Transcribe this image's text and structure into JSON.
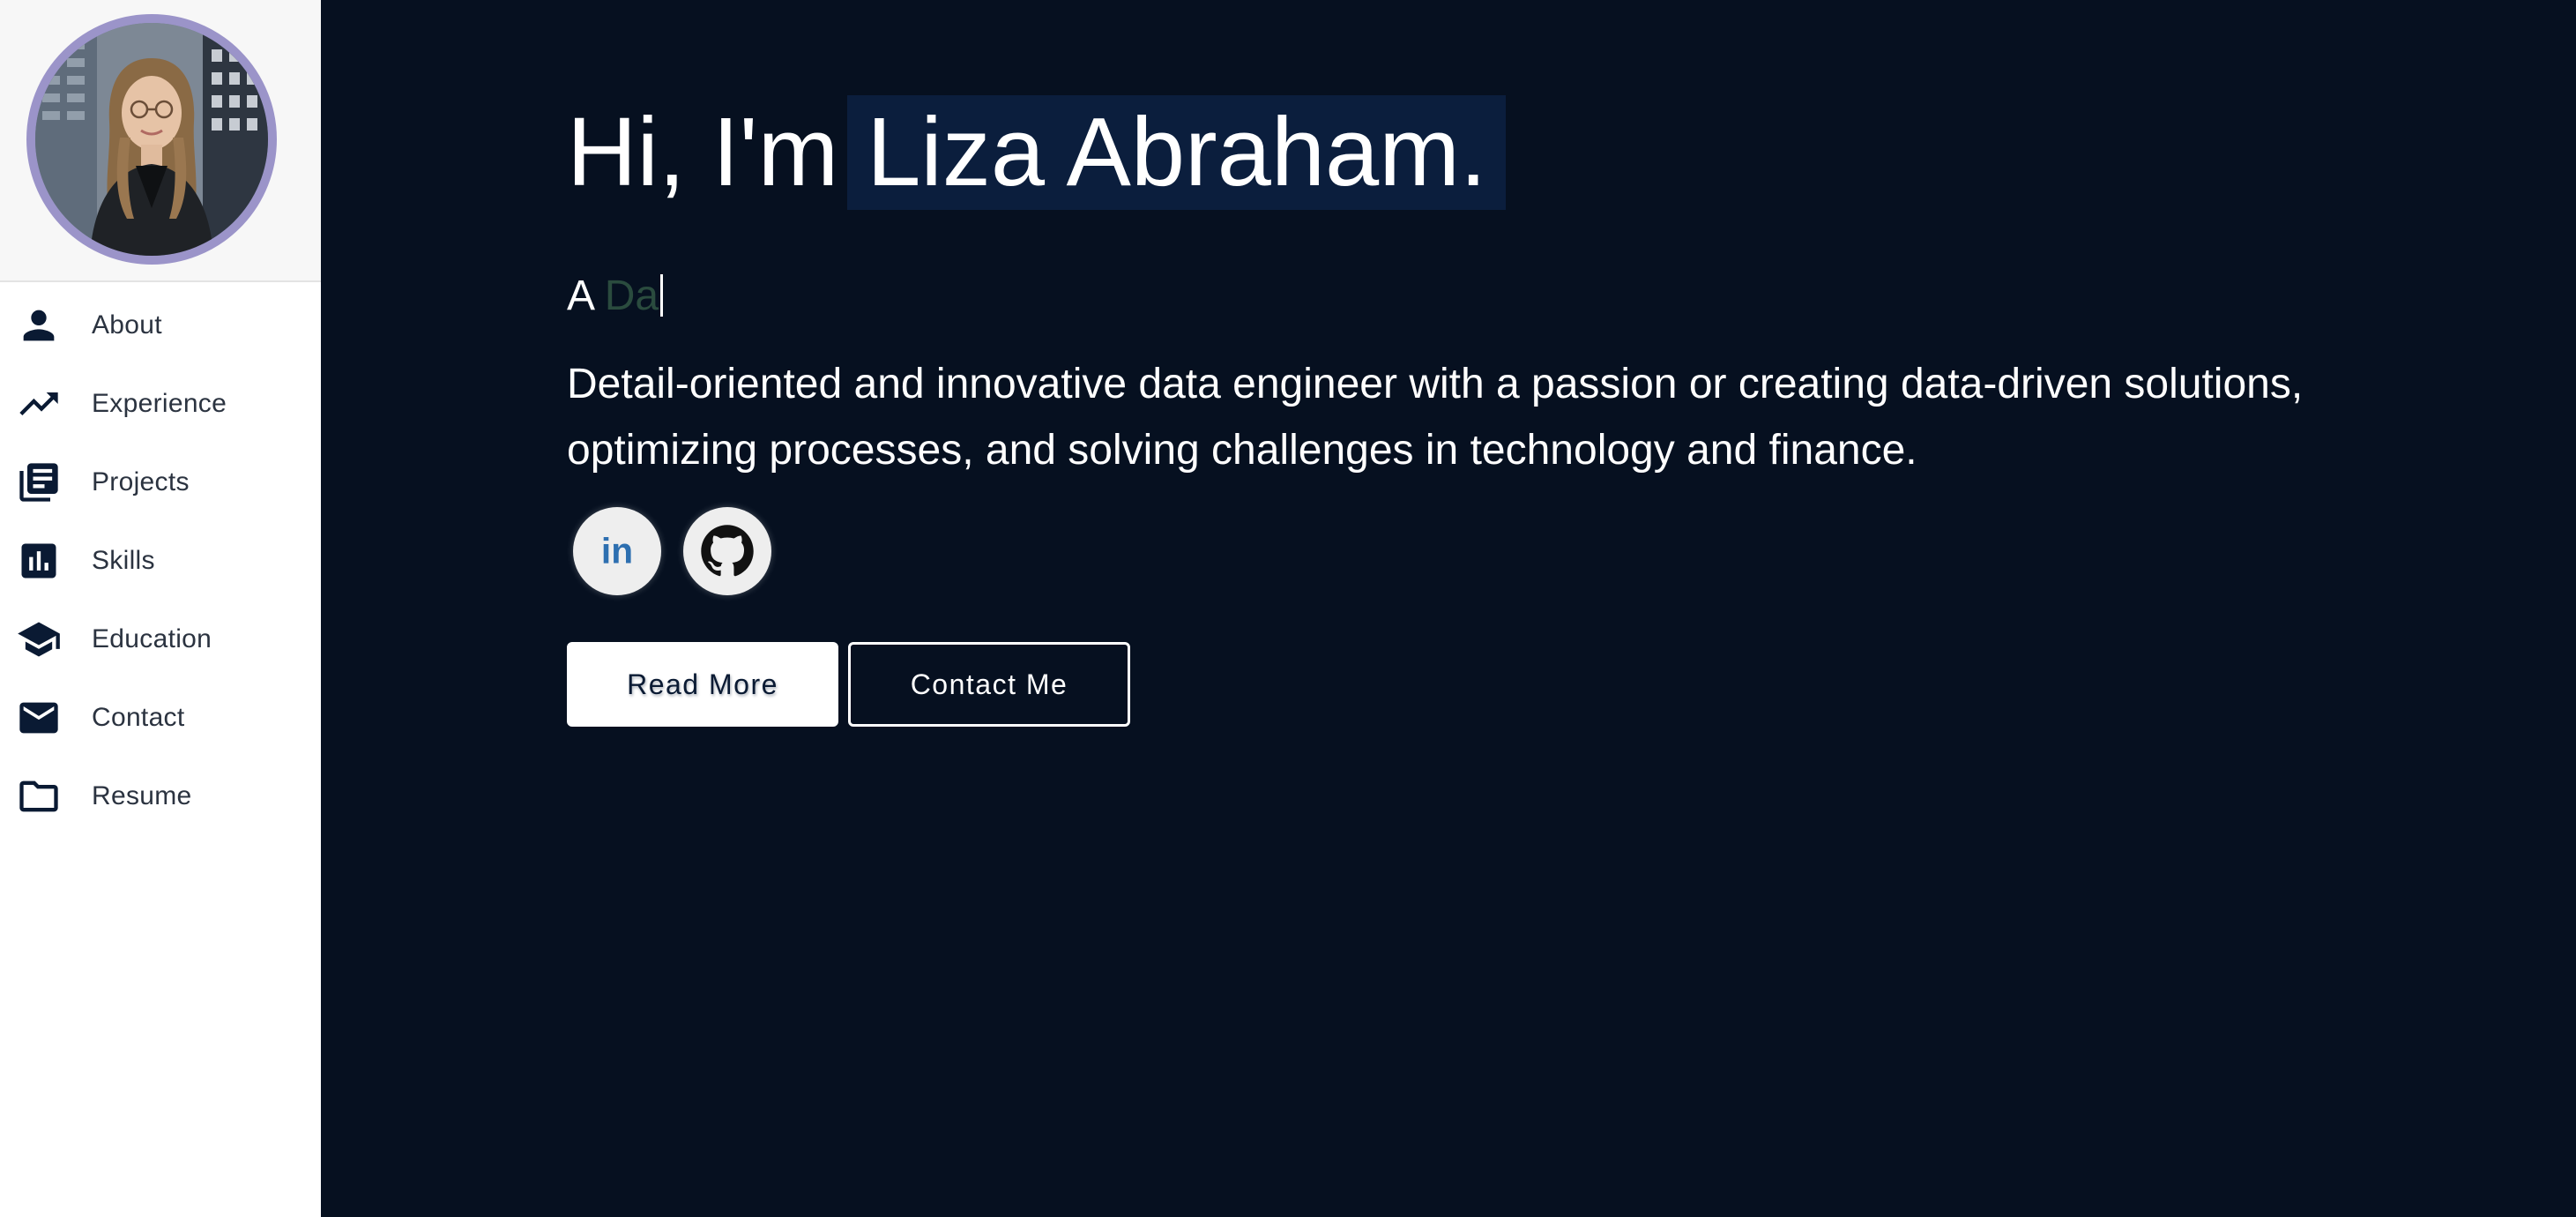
{
  "profile": {
    "photo_alt": "Liza Abraham"
  },
  "nav": {
    "items": [
      {
        "label": "About",
        "icon": "person-icon"
      },
      {
        "label": "Experience",
        "icon": "trending-up-icon"
      },
      {
        "label": "Projects",
        "icon": "library-books-icon"
      },
      {
        "label": "Skills",
        "icon": "bar-chart-icon"
      },
      {
        "label": "Education",
        "icon": "graduation-cap-icon"
      },
      {
        "label": "Contact",
        "icon": "mail-icon"
      },
      {
        "label": "Resume",
        "icon": "folder-icon"
      }
    ]
  },
  "hero": {
    "greeting": "Hi, I'm",
    "name": "Liza Abraham.",
    "typed_prefix": "A",
    "typed_text": "Da",
    "description": "Detail-oriented and innovative data engineer with a passion or creating data-driven solutions, optimizing processes, and solving challenges in technology and finance."
  },
  "social": {
    "linkedin_label": "in"
  },
  "buttons": {
    "read_more": "Read More",
    "contact_me": "Contact Me"
  },
  "colors": {
    "main_background": "#061020",
    "name_highlight": "#0b1e3d",
    "sidebar_icon": "#0a1a33",
    "avatar_ring": "#9b94c9",
    "typed_text": "#2a4b3e",
    "linkedin_blue": "#2d6fb0"
  }
}
